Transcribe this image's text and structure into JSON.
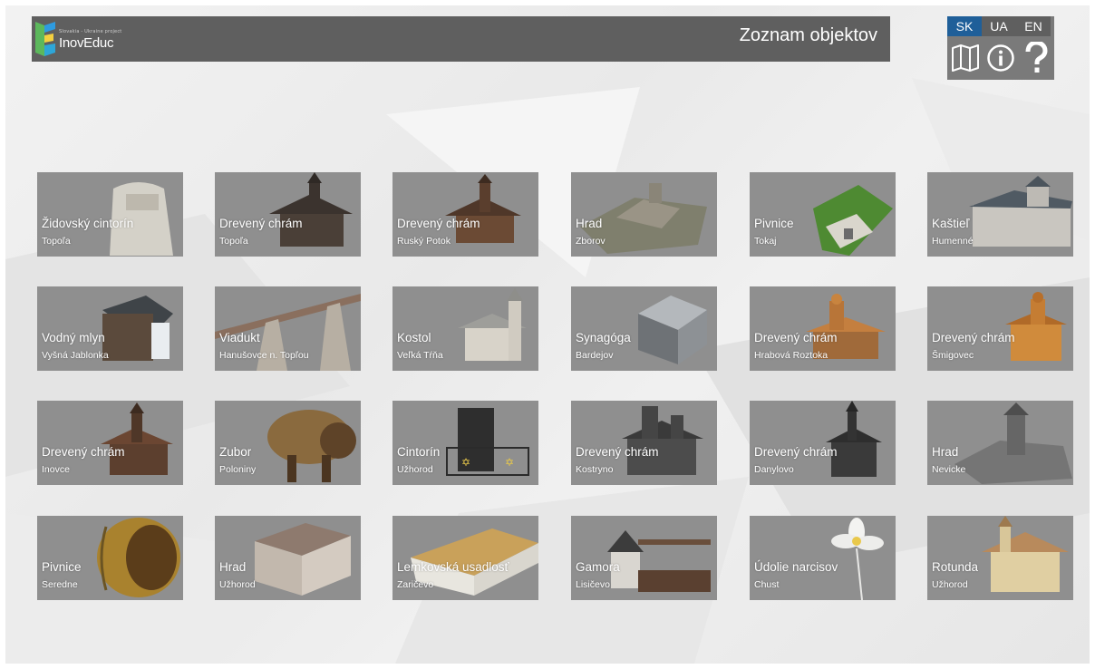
{
  "header": {
    "logo_small": "Slovakia - Ukraine project",
    "logo_text": "InovEduc",
    "title": "Zoznam objektov"
  },
  "languages": [
    {
      "label": "SK",
      "active": true
    },
    {
      "label": "UA",
      "active": false
    },
    {
      "label": "EN",
      "active": false
    }
  ],
  "toolbar_icons": [
    "map-icon",
    "info-icon",
    "help-icon"
  ],
  "colors": {
    "header_bg": "#5f5f5f",
    "active_lang": "#1f5f99",
    "tile_bg": "#8f8f8f"
  },
  "objects": [
    {
      "name": "Židovský cintorín",
      "location": "Topoľa",
      "icon": "gravestone-icon"
    },
    {
      "name": "Drevený chrám",
      "location": "Topoľa",
      "icon": "wooden-church-icon"
    },
    {
      "name": "Drevený chrám",
      "location": "Ruský Potok",
      "icon": "wooden-church-icon"
    },
    {
      "name": "Hrad",
      "location": "Zborov",
      "icon": "castle-ruins-icon"
    },
    {
      "name": "Pivnice",
      "location": "Tokaj",
      "icon": "wine-cellar-icon"
    },
    {
      "name": "Kaštieľ",
      "location": "Humenné",
      "icon": "manor-house-icon"
    },
    {
      "name": "Vodný mlyn",
      "location": "Vyšná Jablonka",
      "icon": "water-mill-icon"
    },
    {
      "name": "Viadukt",
      "location": "Hanušovce n. Topľou",
      "icon": "viaduct-icon"
    },
    {
      "name": "Kostol",
      "location": "Veľká Tŕňa",
      "icon": "church-icon"
    },
    {
      "name": "Synagóga",
      "location": "Bardejov",
      "icon": "synagogue-icon"
    },
    {
      "name": "Drevený chrám",
      "location": "Hrabová Roztoka",
      "icon": "wooden-church-icon"
    },
    {
      "name": "Drevený chrám",
      "location": "Šmigovec",
      "icon": "wooden-church-icon"
    },
    {
      "name": "Drevený chrám",
      "location": "Inovce",
      "icon": "wooden-church-icon"
    },
    {
      "name": "Zubor",
      "location": "Poloniny",
      "icon": "bison-icon"
    },
    {
      "name": "Cintorín",
      "location": "Užhorod",
      "icon": "cemetery-icon"
    },
    {
      "name": "Drevený chrám",
      "location": "Kostryno",
      "icon": "wooden-church-icon"
    },
    {
      "name": "Drevený chrám",
      "location": "Danylovo",
      "icon": "wooden-church-icon"
    },
    {
      "name": "Hrad",
      "location": "Nevicke",
      "icon": "castle-ruins-icon"
    },
    {
      "name": "Pivnice",
      "location": "Seredne",
      "icon": "barrel-icon"
    },
    {
      "name": "Hrad",
      "location": "Užhorod",
      "icon": "castle-icon"
    },
    {
      "name": "Lemkovská usadlosť",
      "location": "Zaričevo",
      "icon": "farmstead-icon"
    },
    {
      "name": "Gamora",
      "location": "Lisičevo",
      "icon": "forge-icon"
    },
    {
      "name": "Údolie narcisov",
      "location": "Chust",
      "icon": "narcissus-icon"
    },
    {
      "name": "Rotunda",
      "location": "Užhorod",
      "icon": "rotunda-icon"
    }
  ]
}
